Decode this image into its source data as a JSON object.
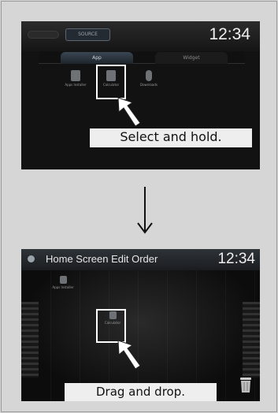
{
  "screen1": {
    "source_label": "SOURCE",
    "clock": "12:34",
    "tabs": [
      {
        "label": "App"
      },
      {
        "label": "Widget"
      }
    ],
    "apps": [
      {
        "label": "Apps Installer"
      },
      {
        "label": "Calculator"
      },
      {
        "label": "Downloads"
      }
    ],
    "caption": "Select and hold."
  },
  "screen2": {
    "title": "Home Screen Edit Order",
    "clock": "12:34",
    "apps": [
      {
        "label": "Apps Installer"
      },
      {
        "label": "Calculator"
      }
    ],
    "caption": "Drag and drop."
  },
  "colors": {
    "screen_bg": "#121212",
    "highlight": "#ffffff",
    "caption_bg": "#eeeeee",
    "frame_bg": "#d6d6d6"
  }
}
